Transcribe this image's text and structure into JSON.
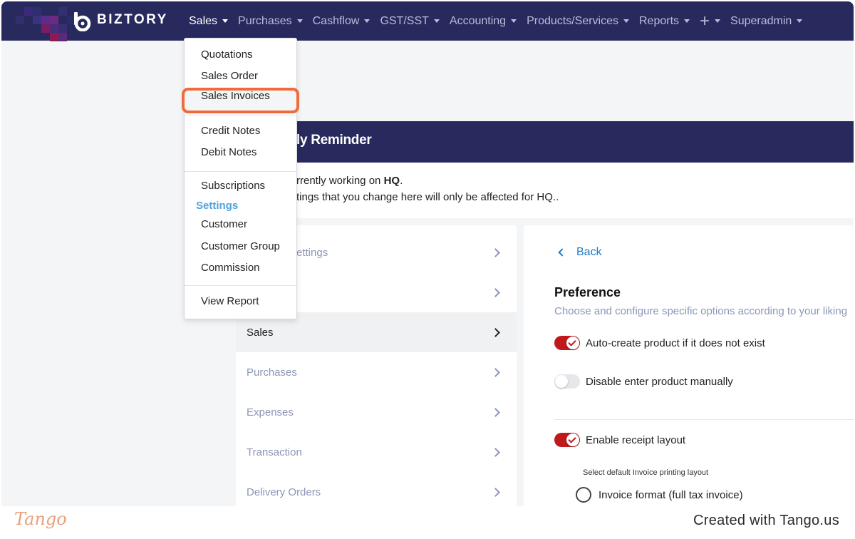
{
  "app": {
    "brand": "BIZTORY"
  },
  "nav": {
    "items": [
      {
        "label": "Sales",
        "active": true
      },
      {
        "label": "Purchases"
      },
      {
        "label": "Cashflow"
      },
      {
        "label": "GST/SST"
      },
      {
        "label": "Accounting"
      },
      {
        "label": "Products/Services"
      },
      {
        "label": "Reports"
      },
      {
        "label": "+"
      },
      {
        "label": "Superadmin"
      }
    ]
  },
  "sales_dropdown": {
    "items": [
      "Quotations",
      "Sales Order",
      "Sales Invoices",
      "Credit Notes",
      "Debit Notes",
      "Subscriptions",
      "Customer",
      "Customer Group",
      "Commission",
      "View Report"
    ],
    "settings_heading": "Settings",
    "highlighted_item": "Sales Invoices"
  },
  "reminder": {
    "title": "ly Reminder",
    "line1_prefix": "rrently working on ",
    "line1_bold": "HQ",
    "line1_suffix": ".",
    "line2": "tings that you change here will only be affected for HQ.."
  },
  "settings_menu": {
    "items": [
      {
        "label": "ettings"
      },
      {
        "label": ""
      },
      {
        "label": "Sales",
        "active": true
      },
      {
        "label": "Purchases"
      },
      {
        "label": "Expenses"
      },
      {
        "label": "Transaction"
      },
      {
        "label": "Delivery Orders"
      }
    ]
  },
  "preference": {
    "back_label": "Back",
    "title": "Preference",
    "subtitle": "Choose and configure specific options according to your liking",
    "toggles": [
      {
        "label": "Auto-create product if it does not exist",
        "on": true
      },
      {
        "label": "Disable enter product manually",
        "on": false
      },
      {
        "label": "Enable receipt layout",
        "on": true
      }
    ],
    "layout_caption": "Select default Invoice printing layout",
    "radio_option": "Invoice format (full tax invoice)"
  },
  "footer": {
    "tango": "Tango",
    "created": "Created with Tango.us"
  },
  "colors": {
    "navbar": "#282a5e",
    "accent_red": "#c0191d",
    "highlight": "#f06b3a",
    "link_blue": "#1f7ac5",
    "settings_blue": "#4fa3dc"
  }
}
